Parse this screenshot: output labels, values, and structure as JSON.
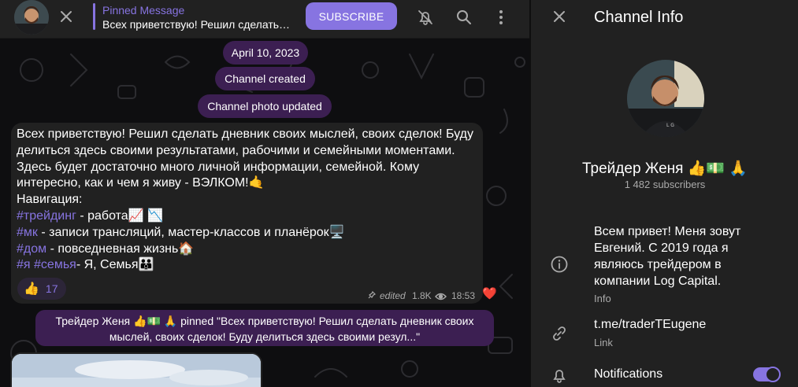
{
  "header": {
    "pinned_title": "Pinned Message",
    "pinned_text": "Всех приветствую! Решил сделать дневник своих мыслей, своих сделок!",
    "subscribe_label": "SUBSCRIBE",
    "icons": {
      "close": "close-icon",
      "mute": "bell-off-icon",
      "search": "search-icon",
      "more": "more-vertical-icon"
    }
  },
  "chat": {
    "date_pill": "April 10, 2023",
    "created_pill": "Channel created",
    "photo_pill": "Channel photo updated",
    "message": {
      "lines": [
        "Всех приветствую! Решил сделать дневник своих мыслей, своих сделок! Буду",
        "делиться здесь своими результатами, рабочими и семейными моментами.",
        "Здесь будет достаточно много личной информации, семейной. Кому",
        "интересно, как и чем я живу - ВЭЛКОМ!🤙",
        "Навигация:"
      ],
      "nav": [
        {
          "tags": [
            "#трейдинг"
          ],
          "text": " - работа📈 📉"
        },
        {
          "tags": [
            "#мк"
          ],
          "text": " - записи трансляций, мастер-классов и планёрок🖥️"
        },
        {
          "tags": [
            "#дом"
          ],
          "text": " - повседневная жизнь🏠"
        },
        {
          "tags": [
            "#я",
            "#семья"
          ],
          "text": "- Я, Семья👪"
        }
      ],
      "reaction_emoji": "👍",
      "reaction_count": "17",
      "edited_label": "edited",
      "views": "1.8K",
      "time": "18:53",
      "my_reaction": "❤️"
    },
    "service_text": "Трейдер Женя 👍💵 🙏 pinned \"Всех приветствую! Решил сделать дневник своих мыслей, своих сделок! Буду делиться здесь своими резул...\""
  },
  "info": {
    "title": "Channel Info",
    "channel_name": "Трейдер Женя 👍💵 🙏",
    "subscribers": "1 482 subscribers",
    "about": "Всем привет! Меня зовут Евгений. С 2019 года я являюсь трейдером в компании Log Capital.",
    "about_label": "Info",
    "link": "t.me/traderTEugene",
    "link_label": "Link",
    "notifications_label": "Notifications",
    "notifications_on": true
  },
  "colors": {
    "accent": "#8774e1",
    "service_bg": "#3c1f52",
    "panel": "#212121",
    "heart": "#e53935"
  }
}
